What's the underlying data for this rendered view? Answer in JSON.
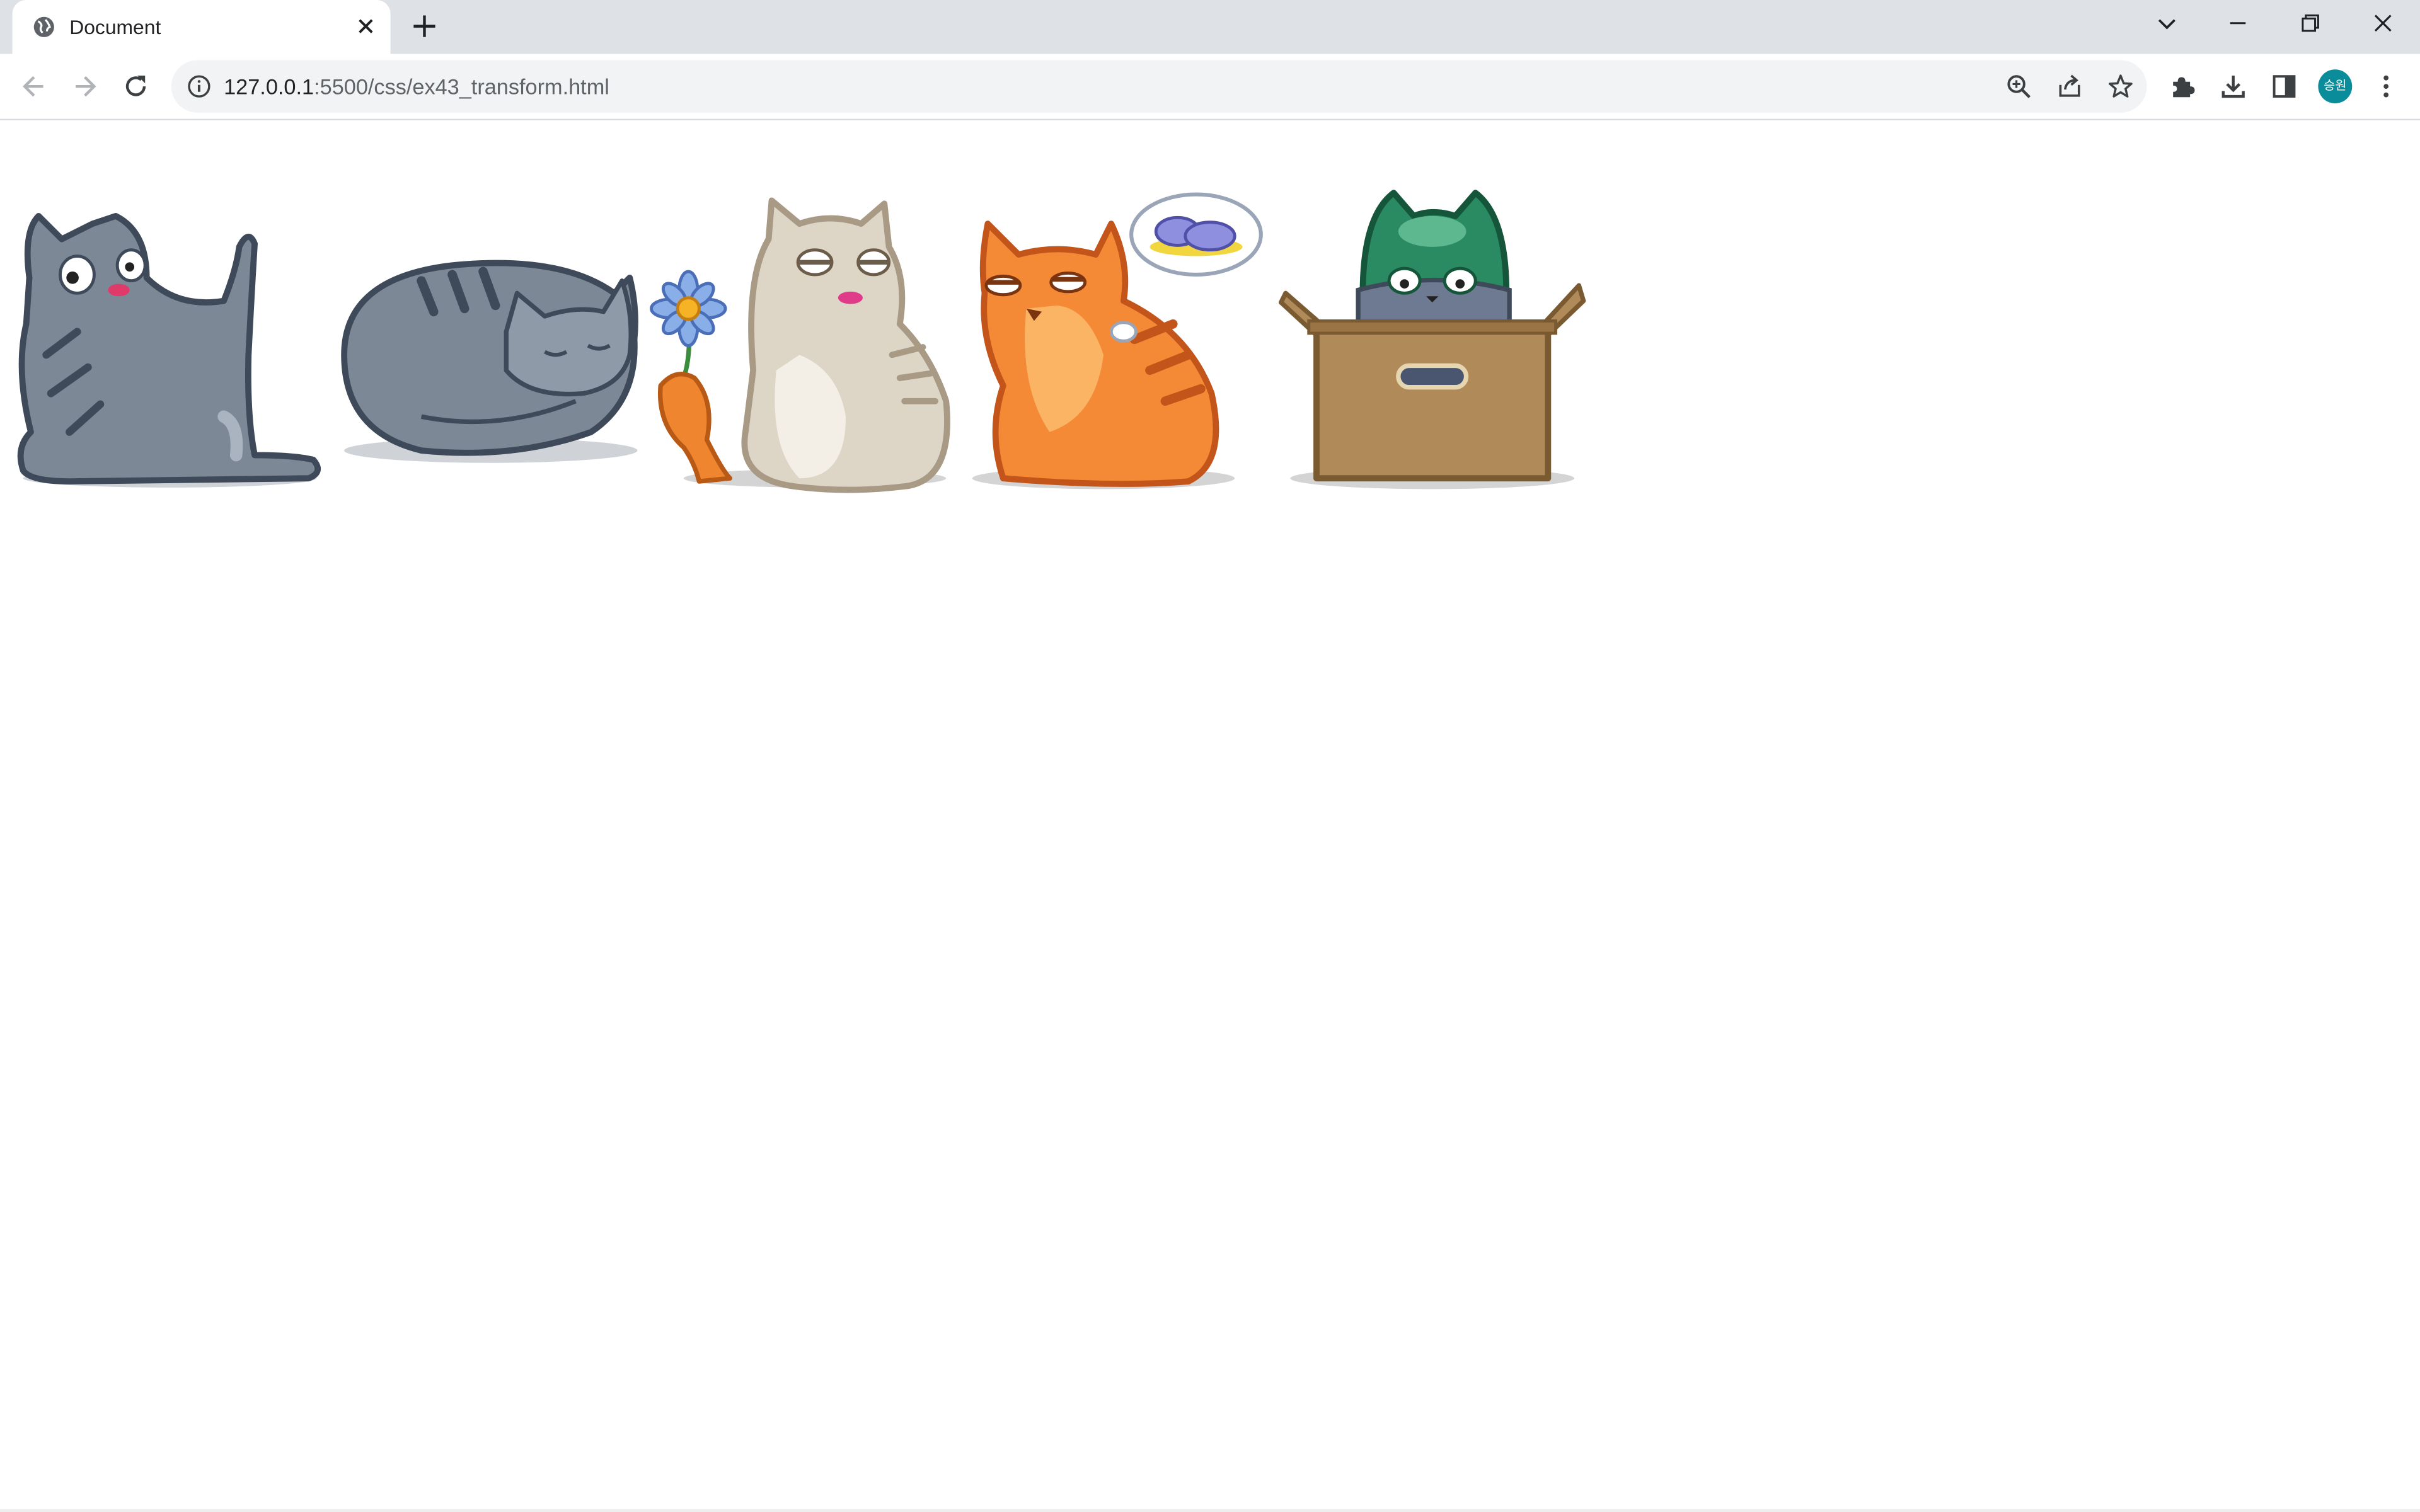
{
  "browser": {
    "tab": {
      "title": "Document",
      "favicon": "globe-icon"
    },
    "address_bar": {
      "host": "127.0.0.1",
      "path": ":5500/css/ex43_transform.html"
    },
    "profile_avatar_text": "승원",
    "profile_avatar_color": "#0b8c9b"
  },
  "page": {
    "images": [
      {
        "name": "gray-cat-stretching"
      },
      {
        "name": "gray-cat-sleeping"
      },
      {
        "name": "beige-cat-with-flower"
      },
      {
        "name": "orange-cat-dreaming-slippers"
      },
      {
        "name": "cat-in-box-with-helmet"
      }
    ]
  }
}
